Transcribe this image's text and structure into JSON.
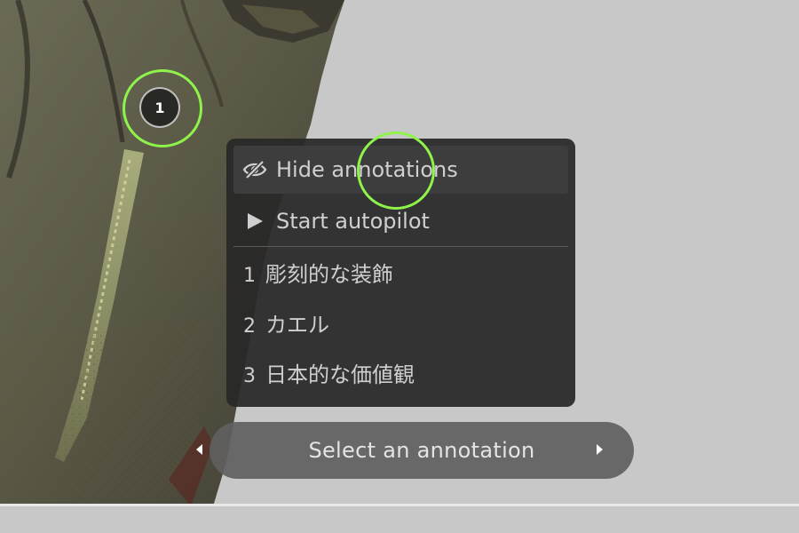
{
  "viewer": {
    "hotspot_number": "1",
    "accent_color": "#8ef34a"
  },
  "menu": {
    "hide_annotations": "Hide annotations",
    "hide_icon": "eye-slash-icon",
    "start_autopilot": "Start autopilot",
    "autopilot_icon": "play-icon",
    "annotations": [
      {
        "number": "1",
        "label": "彫刻的な装飾"
      },
      {
        "number": "2",
        "label": "カエル"
      },
      {
        "number": "3",
        "label": "日本的な価値観"
      }
    ]
  },
  "navigation": {
    "label": "Select an annotation",
    "prev_icon": "caret-left-icon",
    "next_icon": "caret-right-icon"
  }
}
